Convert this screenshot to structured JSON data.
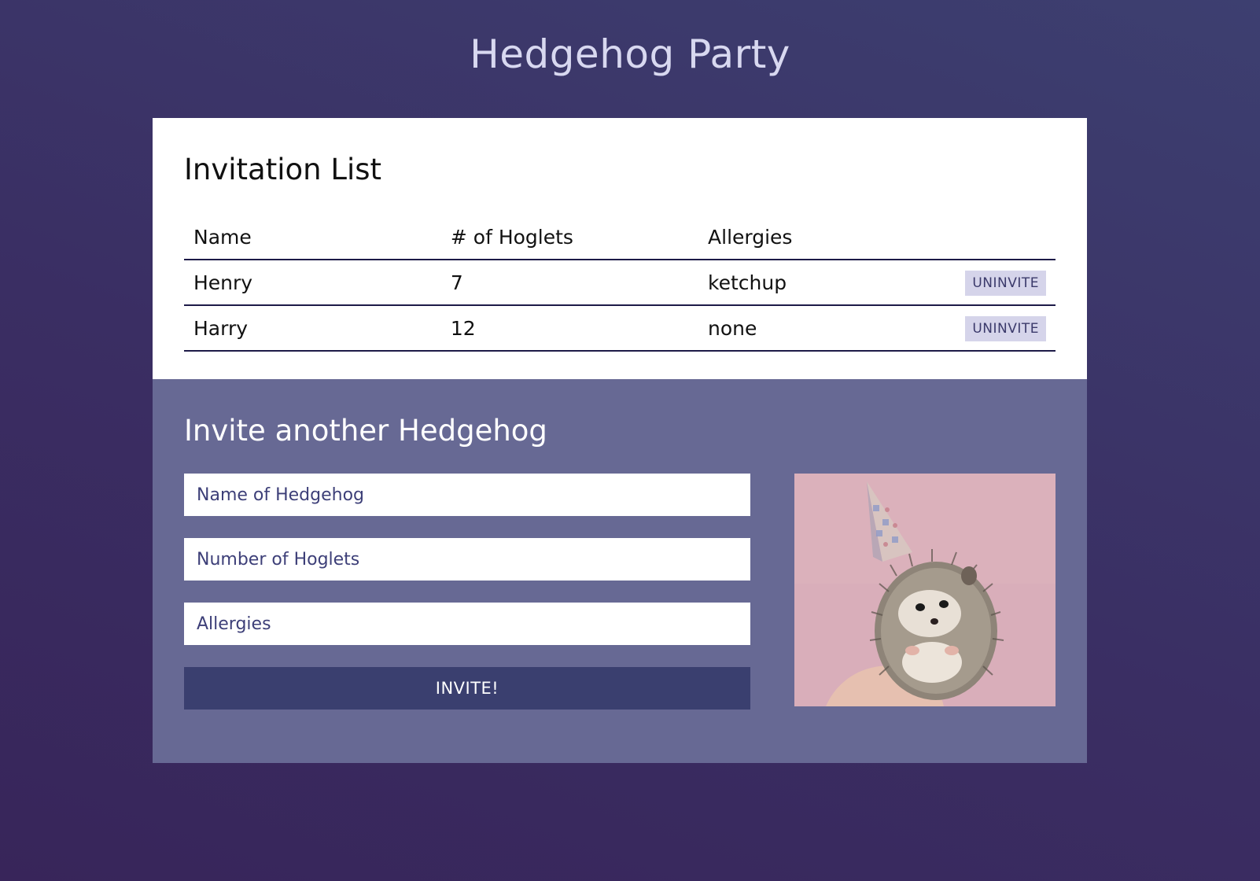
{
  "page": {
    "title": "Hedgehog Party"
  },
  "invitation_list": {
    "heading": "Invitation List",
    "columns": [
      "Name",
      "# of Hoglets",
      "Allergies"
    ],
    "rows": [
      {
        "name": "Henry",
        "hoglets": "7",
        "allergies": "ketchup",
        "action": "UNINVITE"
      },
      {
        "name": "Harry",
        "hoglets": "12",
        "allergies": "none",
        "action": "UNINVITE"
      }
    ]
  },
  "invite_form": {
    "heading": "Invite another Hedgehog",
    "name_placeholder": "Name of Hedgehog",
    "hoglets_placeholder": "Number of Hoglets",
    "allergies_placeholder": "Allergies",
    "submit_label": "INVITE!",
    "photo_icon": "hedgehog-party-hat-photo"
  },
  "colors": {
    "background_top": "#3d3f70",
    "background_bottom": "#38255a",
    "form_panel": "#676994",
    "invite_button": "#3a3f6f",
    "uninvite_button": "#d5d4ea",
    "photo_background": "#d9aeba"
  }
}
